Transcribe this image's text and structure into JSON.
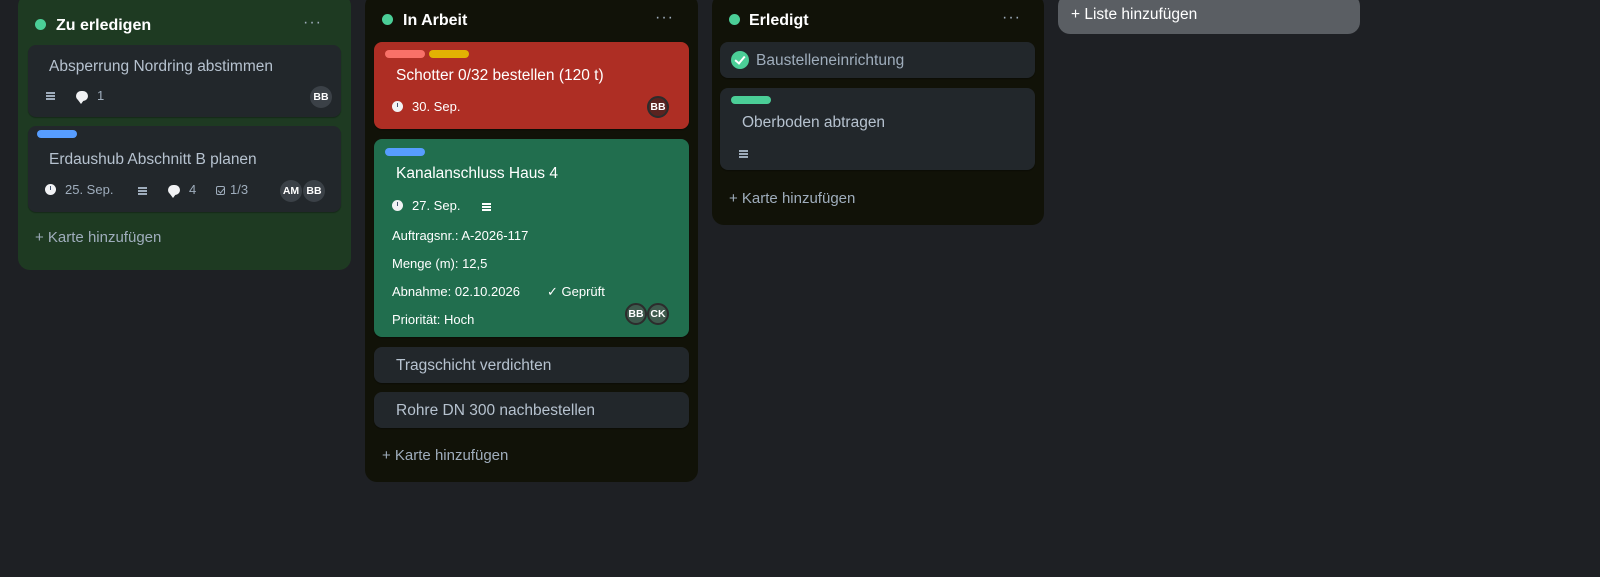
{
  "colors": {
    "board_background": "#1e2024",
    "list_todo_bg": "#1e3a22",
    "list_dark_bg": "#111208",
    "card_bg": "#22272b",
    "card_red": "#ae2e24",
    "card_green": "#216e4e",
    "dot_green": "#4bce97",
    "label_red": "#f87168",
    "label_yellow": "#e2b203",
    "label_blue": "#579dff",
    "label_green": "#4bce97"
  },
  "lists": {
    "todo": {
      "title": "Zu erledigen",
      "more": "···",
      "add_card": "+ Karte hinzufügen",
      "cards": [
        {
          "title": "Absperrung Nordring abstimmen",
          "description_icon": "description-icon",
          "comments": "1",
          "members": [
            "BB"
          ]
        },
        {
          "labels": [
            "blue"
          ],
          "title": "Erdaushub Abschnitt B planen",
          "due": "25. Sep.",
          "description_icon": "description-icon",
          "comments": "4",
          "checklist": "1/3",
          "members": [
            "AM",
            "BB"
          ]
        }
      ]
    },
    "doing": {
      "title": "In Arbeit",
      "more": "···",
      "add_card": "+ Karte hinzufügen",
      "cards": [
        {
          "labels": [
            "red",
            "yellow"
          ],
          "title": "Schotter 0/32 bestellen (120 t)",
          "due": "30. Sep.",
          "members": [
            "BB"
          ]
        },
        {
          "labels": [
            "blue"
          ],
          "title": "Kanalanschluss Haus 4",
          "due": "27. Sep.",
          "description_icon": "description-icon",
          "fields": {
            "auftrag": "Auftragsnr.: A-2026-117",
            "menge": "Menge (m): 12,5",
            "abnahme": "Abnahme: 02.10.2026",
            "geprueft": "✓ Geprüft",
            "prioritaet": "Priorität: Hoch"
          },
          "members": [
            "BB",
            "CK"
          ]
        },
        {
          "title": "Tragschicht verdichten"
        },
        {
          "title": "Rohre DN 300 nachbestellen"
        }
      ]
    },
    "done": {
      "title": "Erledigt",
      "more": "···",
      "add_card": "+ Karte hinzufügen",
      "cards": [
        {
          "title": "Baustelleneinrichtung",
          "completed": true
        },
        {
          "labels": [
            "green"
          ],
          "title": "Oberboden abtragen",
          "description_icon": "description-icon"
        }
      ]
    }
  },
  "add_list": "+ Liste hinzufügen"
}
